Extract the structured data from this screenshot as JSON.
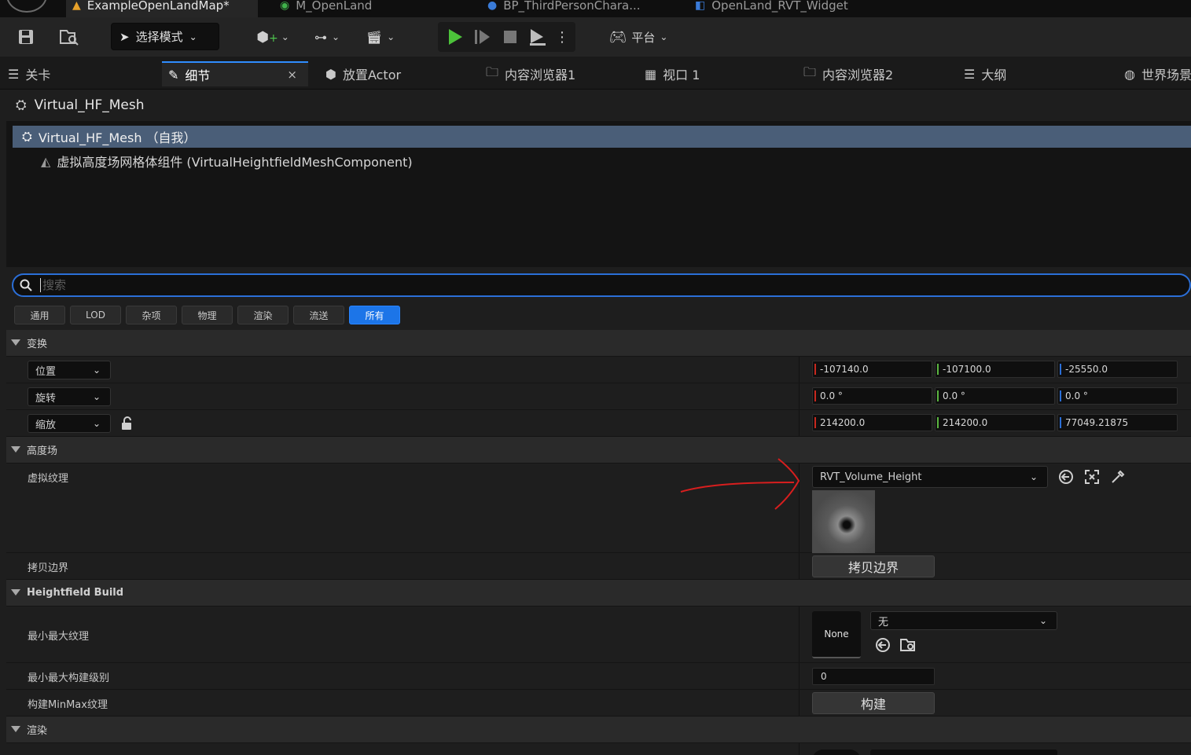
{
  "document_tabs": [
    {
      "label": "ExampleOpenLandMap*",
      "icon": "level-icon",
      "active": true
    },
    {
      "label": "M_OpenLand",
      "icon": "material-icon"
    },
    {
      "label": "BP_ThirdPersonChara...",
      "icon": "blueprint-icon"
    },
    {
      "label": "OpenLand_RVT_Widget",
      "icon": "widget-icon"
    }
  ],
  "toolbar": {
    "mode_label": "选择模式",
    "platform_label": "平台"
  },
  "panel_tabs": [
    {
      "label": "关卡"
    },
    {
      "label": "细节",
      "active": true
    },
    {
      "label": "放置Actor"
    },
    {
      "label": "内容浏览器1"
    },
    {
      "label": "视口 1"
    },
    {
      "label": "内容浏览器2"
    },
    {
      "label": "大纲"
    },
    {
      "label": "世界场景"
    }
  ],
  "details": {
    "actor_name": "Virtual_HF_Mesh",
    "components": [
      {
        "label": "Virtual_HF_Mesh （自我）",
        "selected": true
      },
      {
        "label": "虚拟高度场网格体组件 (VirtualHeightfieldMeshComponent)"
      }
    ],
    "search_placeholder": "搜索",
    "filters": [
      "通用",
      "LOD",
      "杂项",
      "物理",
      "渲染",
      "流送",
      "所有"
    ],
    "active_filter": "所有"
  },
  "transform": {
    "category": "变换",
    "location_label": "位置",
    "rotation_label": "旋转",
    "scale_label": "缩放",
    "location": [
      "-107140.0",
      "-107100.0",
      "-25550.0"
    ],
    "rotation": [
      "0.0 °",
      "0.0 °",
      "0.0 °"
    ],
    "scale": [
      "214200.0",
      "214200.0",
      "77049.21875"
    ]
  },
  "heightfield": {
    "category": "高度场",
    "virtual_texture_label": "虚拟纹理",
    "virtual_texture_value": "RVT_Volume_Height",
    "copy_bounds_label": "拷贝边界",
    "copy_bounds_button": "拷贝边界"
  },
  "heightfield_build": {
    "category": "Heightfield Build",
    "minmax_texture_label": "最小最大纹理",
    "minmax_texture_thumb": "None",
    "minmax_texture_value": "无",
    "minmax_levels_label": "最小最大构建级别",
    "minmax_levels_value": "0",
    "build_minmax_label": "构建MinMax纹理",
    "build_button": "构建"
  },
  "render": {
    "category": "渲染"
  },
  "colors": {
    "accent": "#1c75e8",
    "selection": "#4a5e78",
    "axis_x": "#c8281e",
    "axis_y": "#5ab440",
    "axis_z": "#2a6fd8",
    "annotation": "#d81e1e"
  }
}
